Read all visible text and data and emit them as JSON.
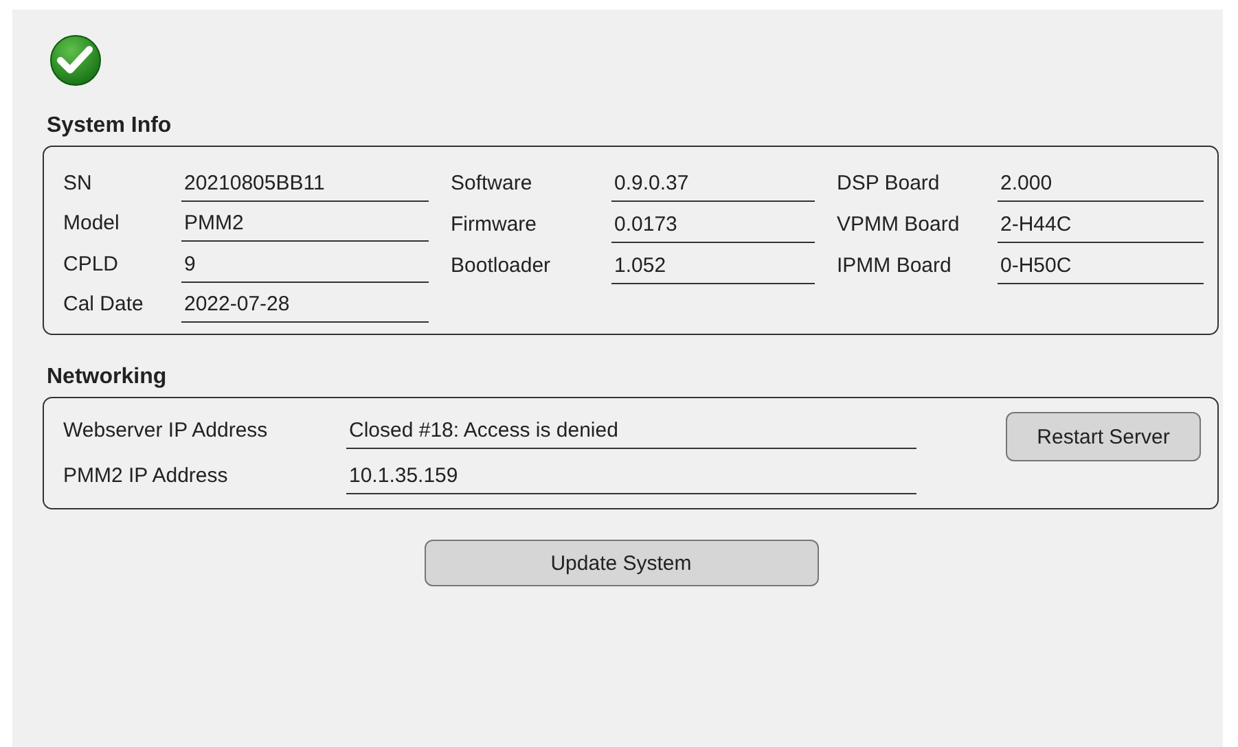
{
  "status_ok": true,
  "system_info": {
    "title": "System Info",
    "columns": [
      [
        {
          "label": "SN",
          "value": "20210805BB11"
        },
        {
          "label": "Model",
          "value": "PMM2"
        },
        {
          "label": "CPLD",
          "value": "9"
        },
        {
          "label": "Cal Date",
          "value": "2022-07-28"
        }
      ],
      [
        {
          "label": "Software",
          "value": "0.9.0.37"
        },
        {
          "label": "Firmware",
          "value": "0.0173"
        },
        {
          "label": "Bootloader",
          "value": "1.052"
        }
      ],
      [
        {
          "label": "DSP Board",
          "value": "2.000"
        },
        {
          "label": "VPMM Board",
          "value": "2-H44C"
        },
        {
          "label": "IPMM Board",
          "value": "0-H50C"
        }
      ]
    ]
  },
  "networking": {
    "title": "Networking",
    "rows": [
      {
        "label": "Webserver IP Address",
        "value": "Closed #18: Access is denied"
      },
      {
        "label": "PMM2 IP Address",
        "value": "10.1.35.159"
      }
    ],
    "button": "Restart Server"
  },
  "update_button": "Update System"
}
